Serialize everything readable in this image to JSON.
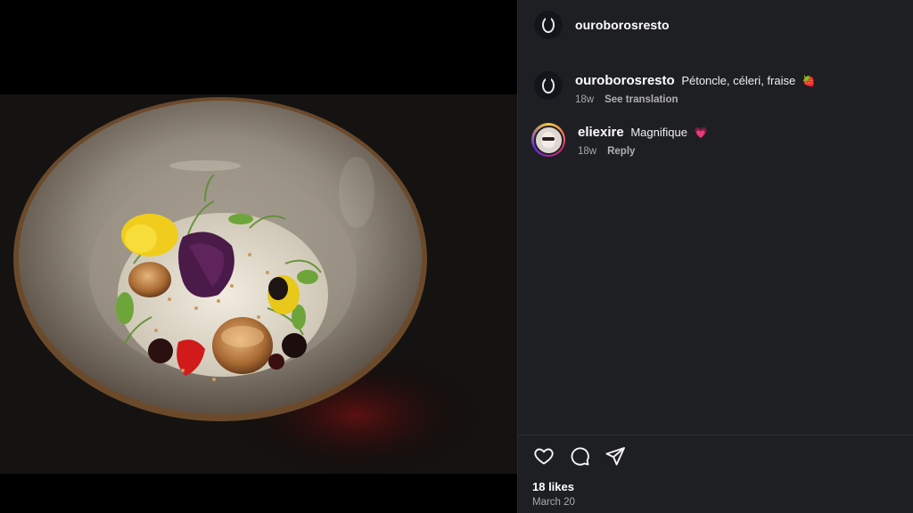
{
  "header": {
    "username": "ouroborosresto"
  },
  "caption": {
    "username": "ouroborosresto",
    "text": "Pétoncle, céleri, fraise",
    "emoji": "🍓",
    "age": "18w",
    "translate_label": "See translation"
  },
  "comments": [
    {
      "username": "eliexire",
      "text": "Magnifique",
      "emoji": "💗",
      "age": "18w",
      "reply_label": "Reply"
    }
  ],
  "footer": {
    "likes": "18 likes",
    "date": "March 20"
  },
  "icons": {
    "like": "heart-icon",
    "comment": "comment-icon",
    "share": "send-icon"
  },
  "colors": {
    "panel_bg": "#1e1f23",
    "text": "#ffffff",
    "muted": "#a8a8a8"
  }
}
